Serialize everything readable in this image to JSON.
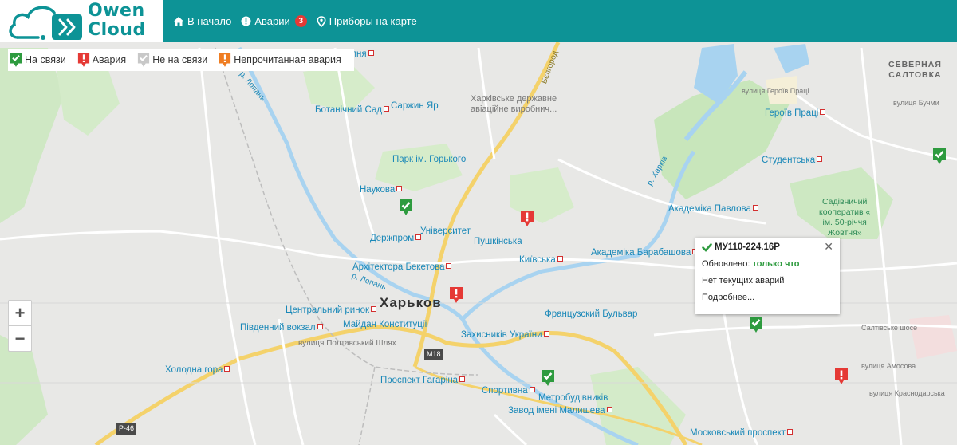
{
  "app": {
    "logo_line1": "Owen",
    "logo_line2": "Cloud"
  },
  "nav": {
    "home_label": "В начало",
    "alarms_label": "Аварии",
    "alarms_count": "3",
    "devices_map_label": "Приборы на карте"
  },
  "legend": {
    "online": "На связи",
    "alarm": "Авария",
    "offline": "Не на связи",
    "unread_alarm": "Непрочитанная авария"
  },
  "colors": {
    "brand": "#0d9396",
    "online": "#2e9b3f",
    "alarm": "#e53935",
    "offline": "#c8c8c8",
    "unread_alarm": "#ef7d22"
  },
  "zoom": {
    "in": "+",
    "out": "−"
  },
  "popup": {
    "device": "МУ110-224.16Р",
    "updated_label": "Обновлено:",
    "updated_value": "только что",
    "alarm_status": "Нет текущих аварий",
    "details_link": "Подробнее..."
  },
  "map": {
    "city": "Харьков",
    "district_line1": "СЕВЕРНАЯ",
    "district_line2": "САЛТОВКА",
    "places": {
      "botanical": "Ботанічний Сад",
      "sarzhin": "Саржин Яр",
      "plant_line1": "Харківське державне",
      "plant_line2": "авіаційне виробнич...",
      "gorky_park": "Парк ім. Горького",
      "naukova": "Наукова",
      "derzhprom": "Держпром",
      "university": "Університет",
      "pushkinska": "Пушкінська",
      "kyivska": "Київська",
      "beketova": "Архітектора Бекетова",
      "central_market": "Центральний ринок",
      "south_station": "Південний вокзал",
      "constitution": "Майдан Конституції",
      "defenders": "Захисників України",
      "french_blvd": "Французский Бульвар",
      "kholodna_gora": "Холодна гора",
      "gagarina": "Проспект Гагаріна",
      "sportyvna": "Спортивна",
      "metrobudivnykiv": "Метробудівників",
      "malyshev": "Завод імені Малишева",
      "moskovsky": "Московський проспект",
      "heroiv_pratsi": "Героїв Праці",
      "studentska": "Студентська",
      "pavlova": "Академіка Павлова",
      "barabashova": "Академіка Барабашова",
      "coop_line1": "Садівничий",
      "coop_line2": "кооператив «",
      "coop_line3": "ім. 50-річчя",
      "coop_line4": "Жовтня»",
      "pisarna": "ерпня",
      "poltava_road": "вулиця Полтавський Шлях",
      "m18": "М18",
      "p46": "Р-46",
      "lopan1": "р. Лопань",
      "lopan2": "р. Лопань",
      "kharkiv_river": "р. Харків",
      "belgorod": "Бєлгород",
      "street_bucmy": "вулиця Бучми",
      "street_heroiv": "вулиця Героїв Праці",
      "street_saltivske": "Салтівське шосе",
      "street_amosova": "вулиця Амосова",
      "street_krasnodarska": "вулиця Краснодарська"
    }
  }
}
